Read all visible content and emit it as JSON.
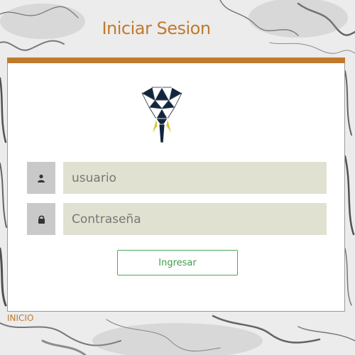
{
  "page": {
    "title": "Iniciar Sesion",
    "accent_color": "#c07a2c"
  },
  "logo": {
    "icon": "elephant-logo-icon"
  },
  "form": {
    "username": {
      "placeholder": "usuario",
      "value": "",
      "icon": "user-icon"
    },
    "password": {
      "placeholder": "Contraseña",
      "value": "",
      "icon": "lock-icon"
    },
    "submit_label": "Ingresar",
    "submit_color": "#4ca85a"
  },
  "footer": {
    "link_label": "INICIO"
  }
}
